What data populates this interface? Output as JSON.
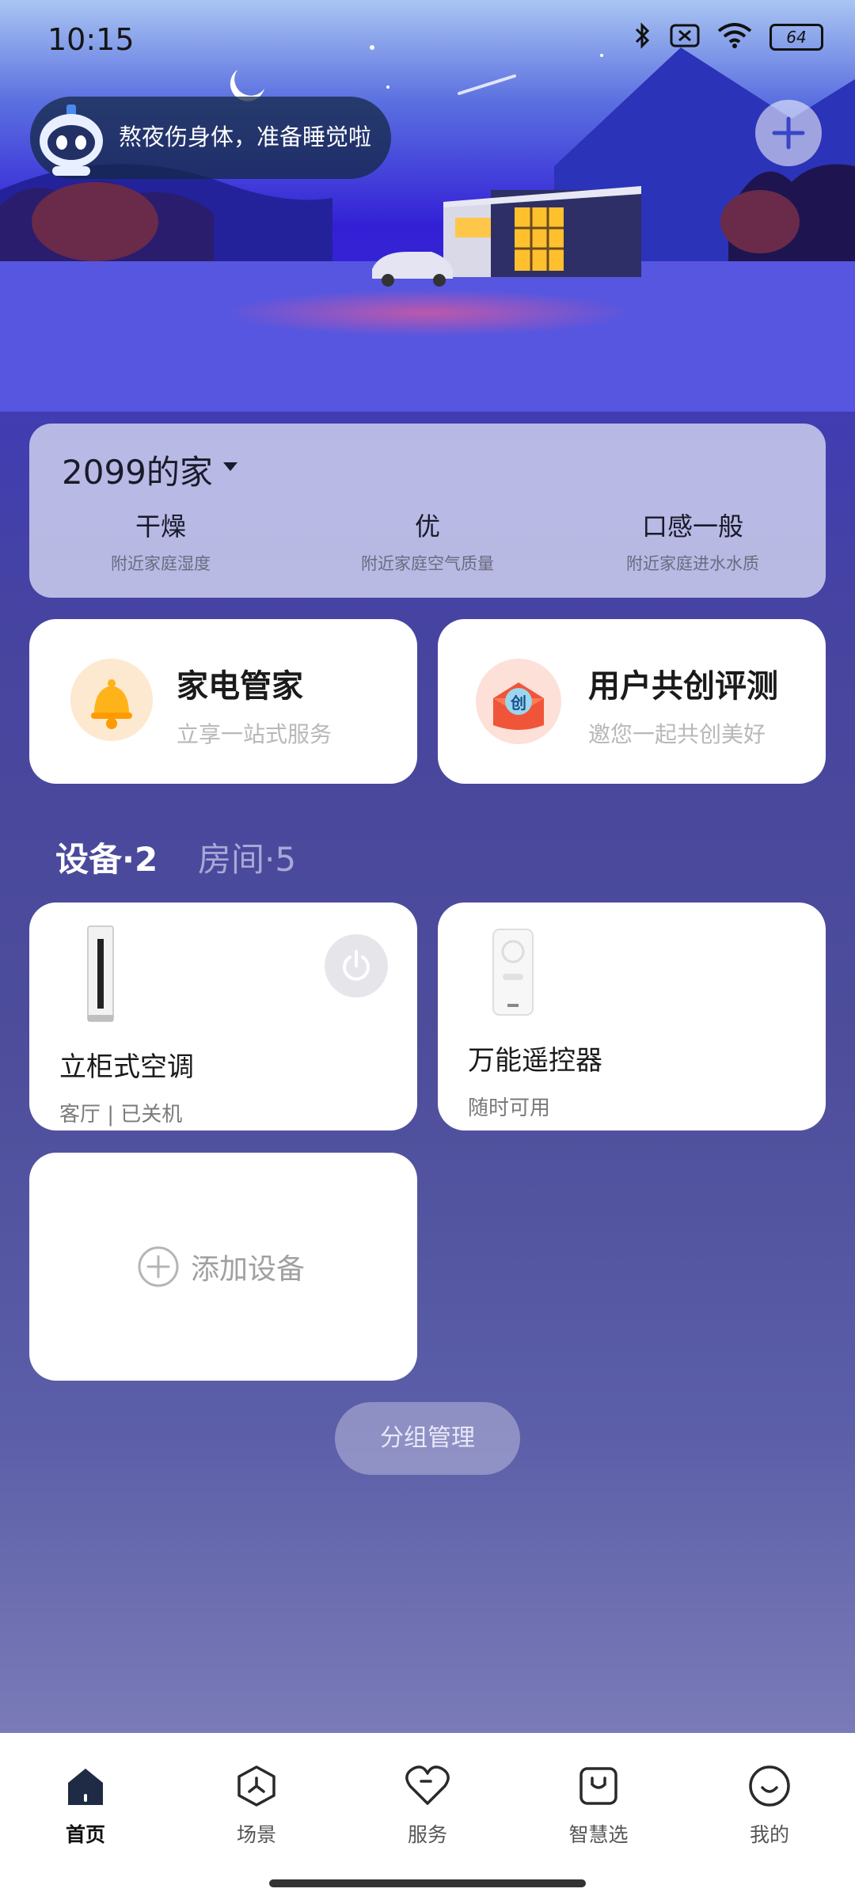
{
  "status_bar": {
    "time": "10:15",
    "battery": "64"
  },
  "header": {
    "tip": "熬夜伤身体，准备睡觉啦"
  },
  "home_card": {
    "home_name": "2099的家",
    "env": [
      {
        "value": "干燥",
        "label": "附近家庭湿度"
      },
      {
        "value": "优",
        "label": "附近家庭空气质量"
      },
      {
        "value": "口感一般",
        "label": "附近家庭进水水质"
      }
    ]
  },
  "features": [
    {
      "title": "家电管家",
      "subtitle": "立享一站式服务"
    },
    {
      "title": "用户共创评测",
      "subtitle": "邀您一起共创美好",
      "badge": "创"
    }
  ],
  "tabs": {
    "devices": "设备·2",
    "rooms": "房间·5"
  },
  "devices": [
    {
      "name": "立柜式空调",
      "status": "客厅 | 已关机"
    },
    {
      "name": "万能遥控器",
      "status": "随时可用"
    }
  ],
  "add_device": "添加设备",
  "group_manage": "分组管理",
  "nav": [
    {
      "label": "首页",
      "icon": "home-icon"
    },
    {
      "label": "场景",
      "icon": "scene-icon"
    },
    {
      "label": "服务",
      "icon": "heart-icon"
    },
    {
      "label": "智慧选",
      "icon": "shopping-bag-icon"
    },
    {
      "label": "我的",
      "icon": "smile-icon"
    }
  ],
  "colors": {
    "nav_active": "#1f2a44",
    "accent": "#3a2fd0"
  }
}
